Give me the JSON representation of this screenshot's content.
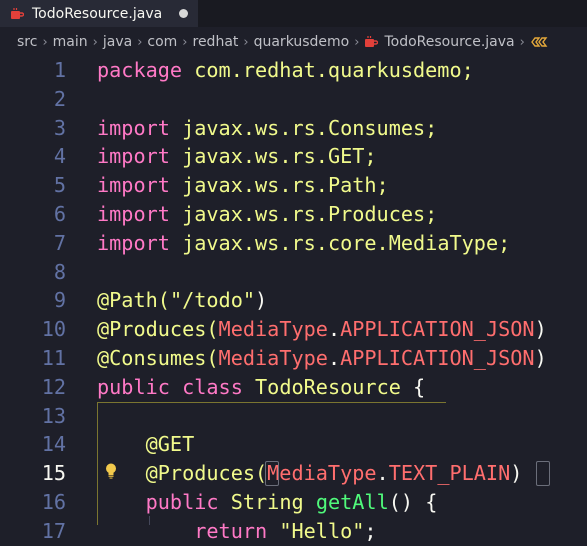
{
  "tab": {
    "filename": "TodoResource.java",
    "icon": "java-coffee-icon"
  },
  "breadcrumb": [
    "src",
    "main",
    "java",
    "com",
    "redhat",
    "quarkusdemo",
    "TodoResource.java"
  ],
  "breadcrumb_trailing_icon": "class-symbol-icon",
  "lines": [
    {
      "n": "1",
      "tokens": [
        [
          "kw",
          "package"
        ],
        [
          "plain",
          " com.redhat.quarkusdemo;"
        ]
      ]
    },
    {
      "n": "2",
      "tokens": []
    },
    {
      "n": "3",
      "tokens": [
        [
          "kw",
          "import"
        ],
        [
          "plain",
          " javax.ws.rs.Consumes;"
        ]
      ]
    },
    {
      "n": "4",
      "tokens": [
        [
          "kw",
          "import"
        ],
        [
          "plain",
          " javax.ws.rs.GET;"
        ]
      ]
    },
    {
      "n": "5",
      "tokens": [
        [
          "kw",
          "import"
        ],
        [
          "plain",
          " javax.ws.rs.Path;"
        ]
      ]
    },
    {
      "n": "6",
      "tokens": [
        [
          "kw",
          "import"
        ],
        [
          "plain",
          " javax.ws.rs.Produces;"
        ]
      ]
    },
    {
      "n": "7",
      "tokens": [
        [
          "kw",
          "import"
        ],
        [
          "plain",
          " javax.ws.rs.core.MediaType;"
        ]
      ]
    },
    {
      "n": "8",
      "tokens": []
    },
    {
      "n": "9",
      "tokens": [
        [
          "plain",
          "@Path("
        ],
        [
          "str",
          "\"/todo\""
        ],
        [
          "plain",
          ")"
        ]
      ]
    },
    {
      "n": "10",
      "tokens": [
        [
          "plain",
          "@Produces("
        ],
        [
          "const",
          "MediaType"
        ],
        [
          "plain",
          "."
        ],
        [
          "const",
          "APPLICATION_JSON"
        ],
        [
          "plain",
          ")"
        ]
      ]
    },
    {
      "n": "11",
      "tokens": [
        [
          "plain",
          "@Consumes("
        ],
        [
          "const",
          "MediaType"
        ],
        [
          "plain",
          "."
        ],
        [
          "const",
          "APPLICATION_JSON"
        ],
        [
          "plain",
          ")"
        ]
      ]
    },
    {
      "n": "12",
      "tokens": [
        [
          "kw",
          "public"
        ],
        [
          "plain",
          " "
        ],
        [
          "kw",
          "class"
        ],
        [
          "plain",
          " "
        ],
        [
          "cls",
          "TodoResource"
        ],
        [
          "plain",
          " {"
        ]
      ]
    },
    {
      "n": "13",
      "tokens": []
    },
    {
      "n": "14",
      "tokens": [
        [
          "plain",
          "    @GET"
        ]
      ]
    },
    {
      "n": "15",
      "tokens": [
        [
          "plain",
          "    @Produces("
        ],
        [
          "const",
          "MediaType"
        ],
        [
          "plain",
          "."
        ],
        [
          "const",
          "TEXT_PLAIN"
        ],
        [
          "plain",
          ")"
        ]
      ]
    },
    {
      "n": "16",
      "tokens": [
        [
          "plain",
          "    "
        ],
        [
          "kw",
          "public"
        ],
        [
          "plain",
          " "
        ],
        [
          "cls",
          "String"
        ],
        [
          "plain",
          " "
        ],
        [
          "fn",
          "getAll"
        ],
        [
          "plain",
          "() {"
        ]
      ]
    },
    {
      "n": "17",
      "tokens": [
        [
          "plain",
          "        "
        ],
        [
          "kw",
          "return"
        ],
        [
          "plain",
          " "
        ],
        [
          "str",
          "\"Hello\""
        ],
        [
          "plain",
          ";"
        ]
      ]
    }
  ],
  "active_line": "15",
  "colors": {
    "background": "#1e1f29",
    "keyword": "#ff79c6",
    "string": "#f1fa8c",
    "constant": "#ff6e6e",
    "class": "#f1fa8c",
    "function": "#50fa7b",
    "line_number": "#6272a4"
  },
  "lightbulb_icon": "lightbulb-icon"
}
